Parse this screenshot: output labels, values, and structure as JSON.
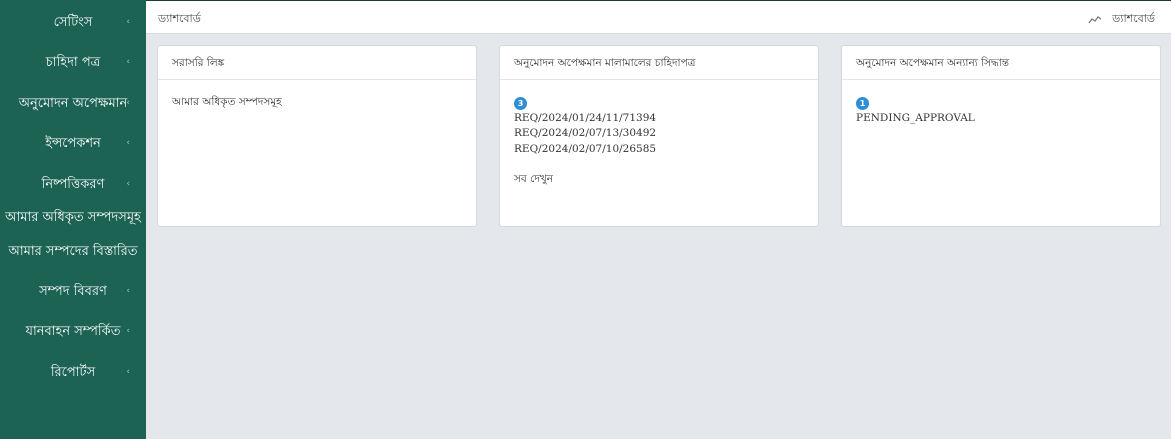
{
  "sidebar": {
    "items": [
      {
        "label": "সেটিংস",
        "has_caret": true
      },
      {
        "label": "চাহিদা পত্র",
        "has_caret": true
      },
      {
        "label": "অনুমোদন অপেক্ষমান",
        "has_caret": true
      },
      {
        "label": "ইন্সপেকশন",
        "has_caret": true
      },
      {
        "label": "নিষ্পত্তিকরণ",
        "has_caret": true
      },
      {
        "label": "আমার অধিকৃত সম্পদসমূহ",
        "has_caret": false
      },
      {
        "label": "আমার সম্পদের বিস্তারিত",
        "has_caret": false
      },
      {
        "label": "সম্পদ বিবরণ",
        "has_caret": true
      },
      {
        "label": "যানবাহন সম্পর্কিত",
        "has_caret": true
      },
      {
        "label": "রিপোর্টস",
        "has_caret": true
      }
    ],
    "caret": "‹"
  },
  "topbar": {
    "breadcrumb": "ড্যাশবোর্ড",
    "dashboard_label": "ড্যাশবোর্ড",
    "icon": "line-chart-icon"
  },
  "panels": {
    "direct_links": {
      "title": "সরাসরি লিঙ্ক",
      "link": "আমার অধিকৃত সম্পদসমূহ"
    },
    "pending_requisitions": {
      "title": "অনুমোদন অপেক্ষমান মালামালের চাহিদাপত্র",
      "count": "3",
      "items": [
        "REQ/2024/01/24/11/71394",
        "REQ/2024/02/07/13/30492",
        "REQ/2024/02/07/10/26585"
      ],
      "see_all": "সব দেখুন"
    },
    "pending_decisions": {
      "title": "অনুমোদন অপেক্ষমান অন্যান্য সিদ্ধান্ত",
      "count": "1",
      "items": [
        "PENDING_APPROVAL"
      ]
    }
  },
  "colors": {
    "sidebar_bg": "#1c6354",
    "page_bg": "#e4e8ec",
    "badge": "#2d8ed6"
  }
}
